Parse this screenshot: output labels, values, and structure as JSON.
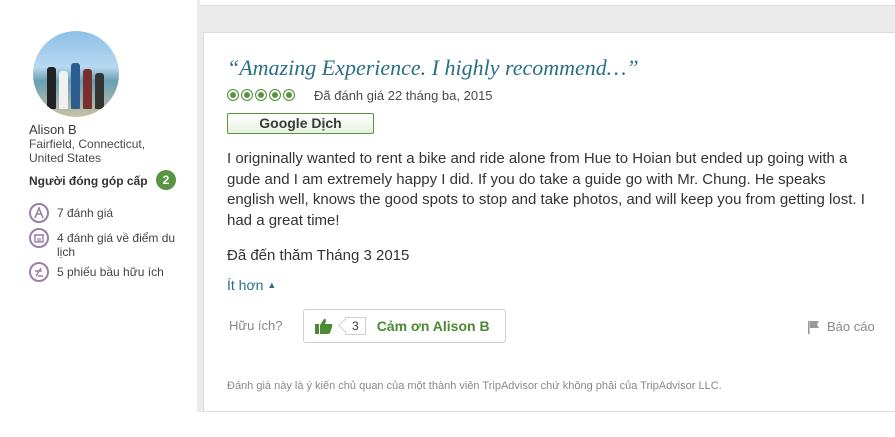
{
  "user": {
    "name": "Alison B",
    "location": "Fairfield, Connecticut, United States",
    "contributor_label": "Người đóng góp cấp",
    "level": "2",
    "stats": [
      {
        "icon": "review-pen-icon",
        "text": "7 đánh giá"
      },
      {
        "icon": "attraction-icon",
        "text": "4 đánh giá về điểm du lịch"
      },
      {
        "icon": "helpful-vote-icon",
        "text": "5 phiếu bầu hữu ích"
      }
    ]
  },
  "review": {
    "title": "“Amazing Experience. I highly recommend…”",
    "rating": 5,
    "rating_max": 5,
    "date": "Đã đánh giá 22 tháng ba, 2015",
    "translate_label": "Google Dịch",
    "body": "I origninally wanted to rent a bike and ride alone from Hue to Hoian but ended up going with a gude and I am extremely happy I did. If you do take a guide go with Mr. Chung. He speaks english well, knows the good spots to stop and take photos, and will keep you from getting lost. I had a great time!",
    "visited": "Đã đến thăm Tháng 3 2015",
    "less_label": "Ít hơn"
  },
  "actions": {
    "helpful_question": "Hữu ích?",
    "thanks_count": "3",
    "thanks_label": "Cảm ơn Alison B",
    "report_label": "Báo cáo"
  },
  "disclaimer": "Đánh giá này là ý kiến chủ quan của một thành viên TripAdvisor chứ không phải của TripAdvisor LLC.",
  "colors": {
    "accent_green": "#589442",
    "link_teal": "#2a6f82",
    "badge_purple": "#9a7fa8"
  }
}
